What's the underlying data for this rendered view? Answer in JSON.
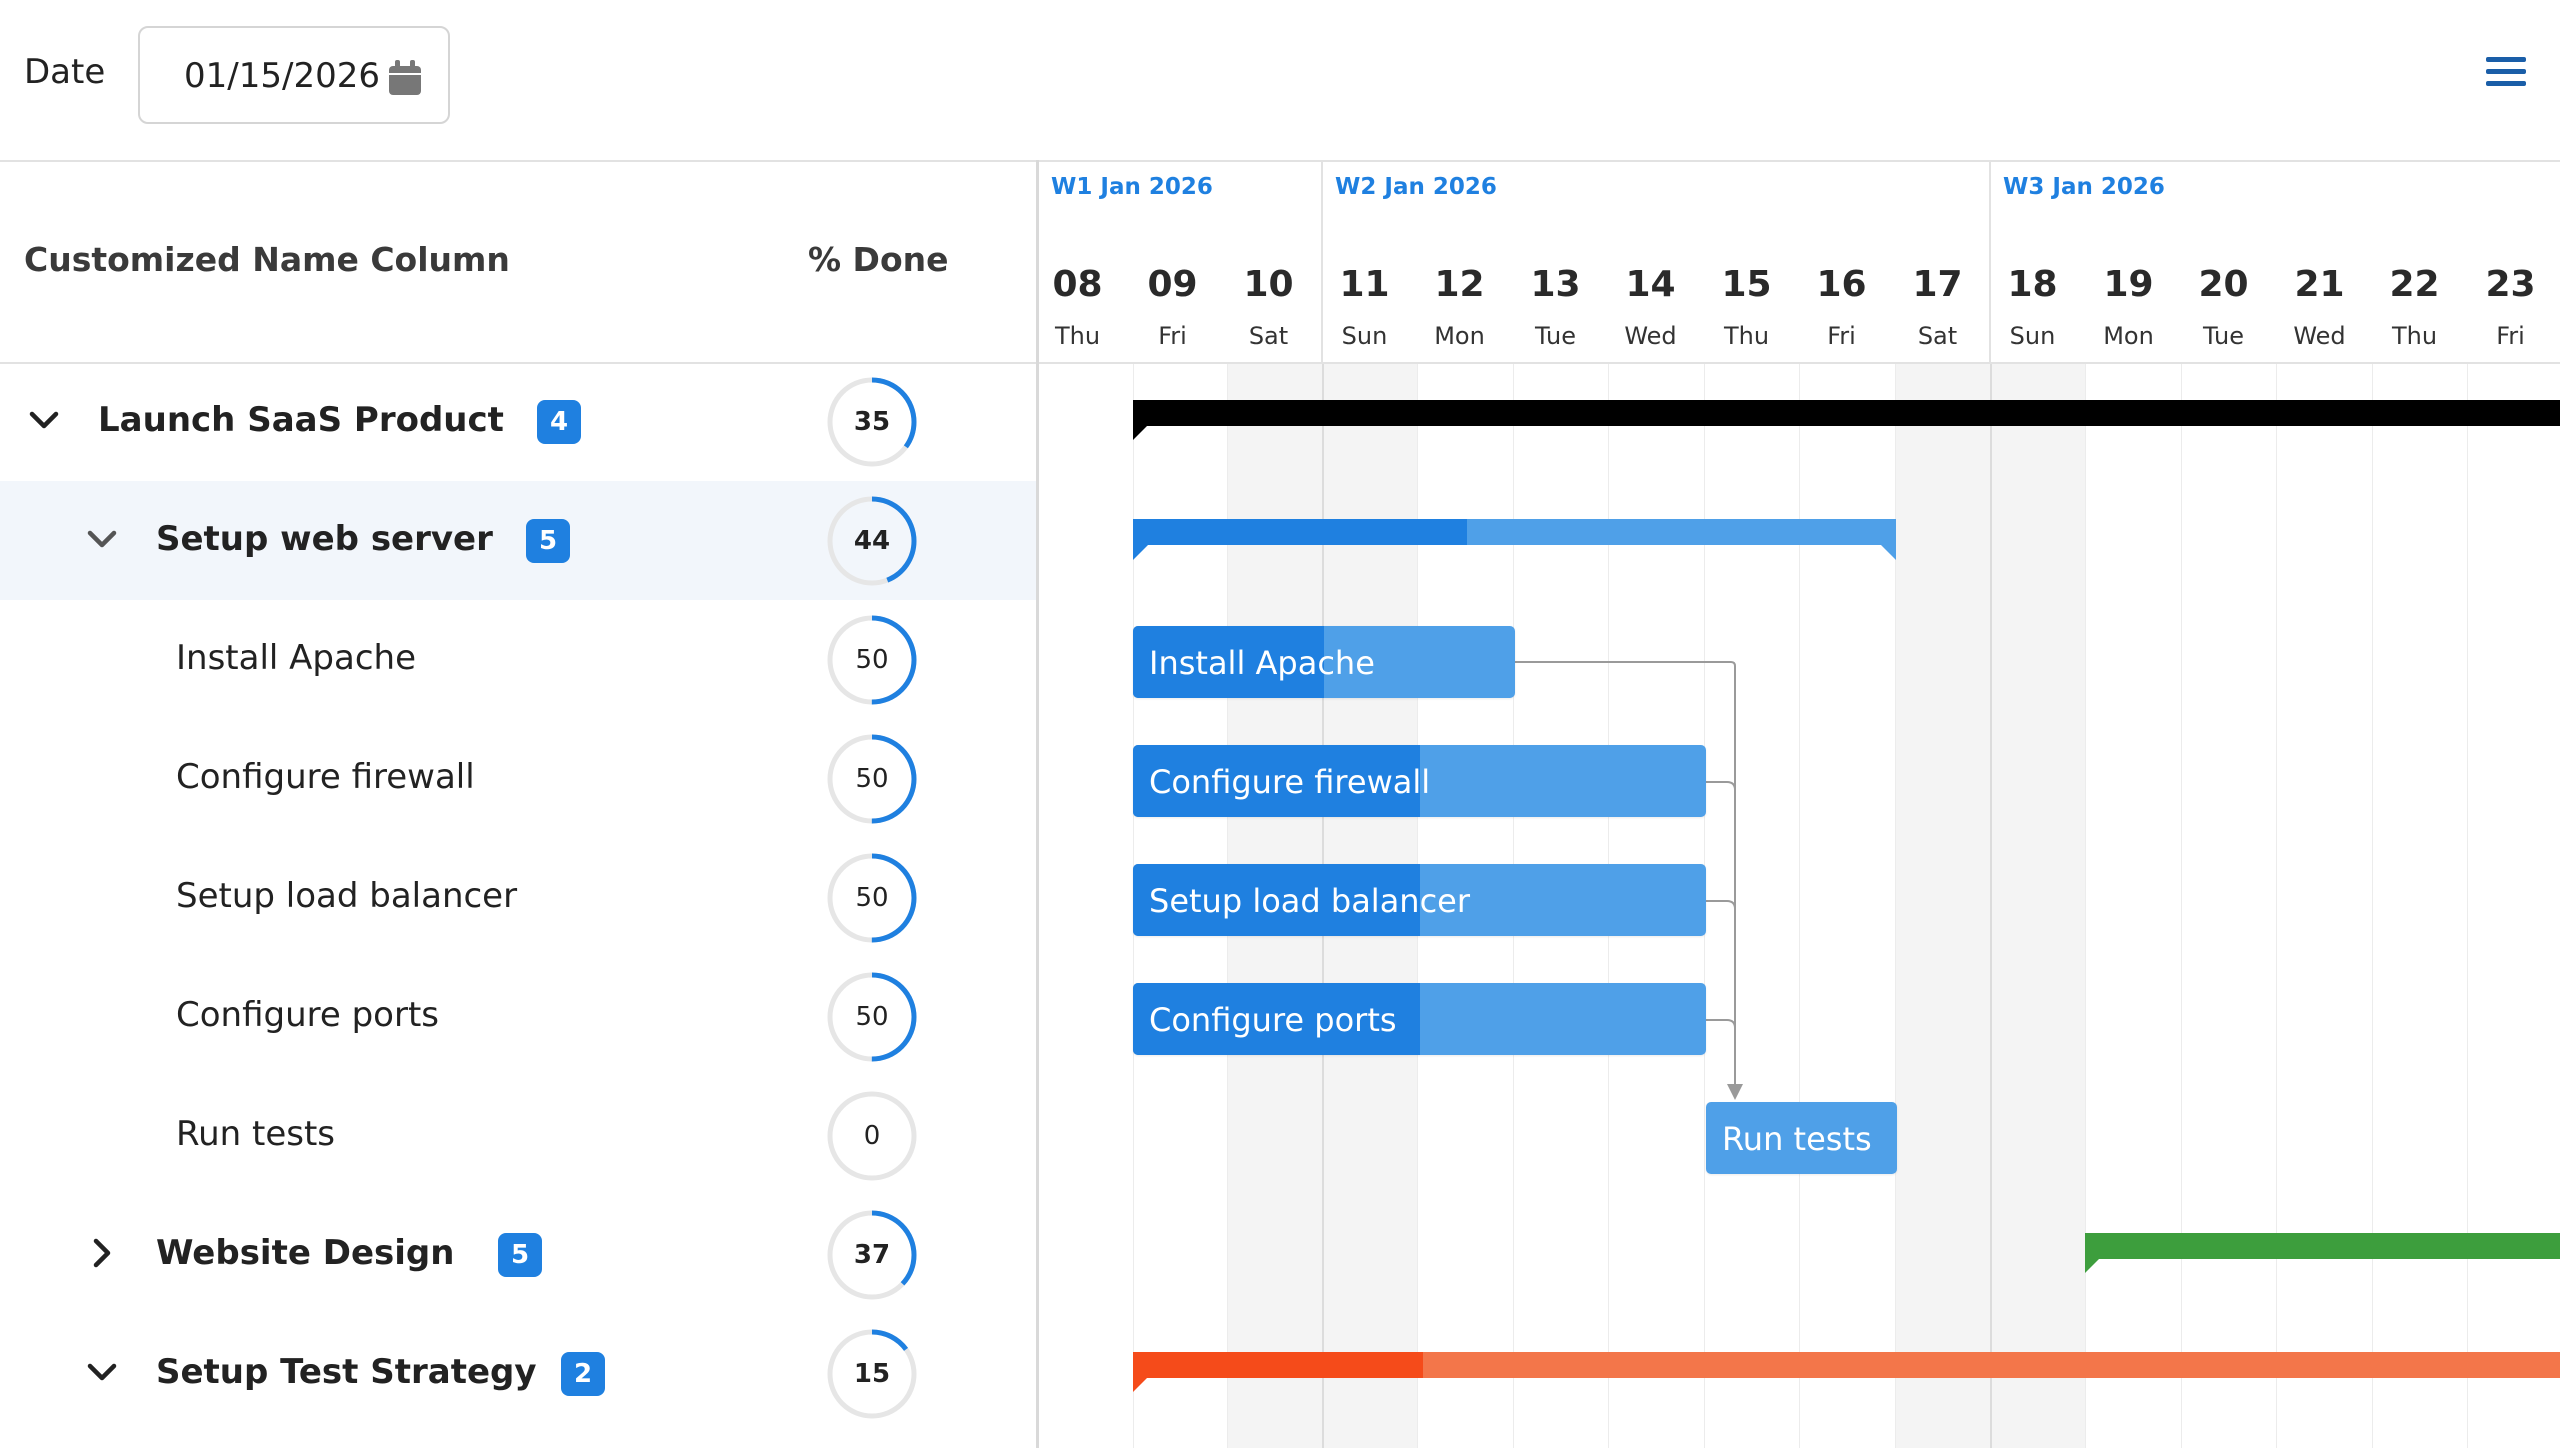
{
  "toolbar": {
    "date_label": "Date",
    "date_value": "01/15/2026"
  },
  "grid": {
    "name_header": "Customized Name Column",
    "done_header": "% Done",
    "rows": [
      {
        "name": "Launch SaaS Product",
        "percent": 35,
        "badge": "4",
        "expanded": true,
        "level": 0
      },
      {
        "name": "Setup web server",
        "percent": 44,
        "badge": "5",
        "expanded": true,
        "level": 1
      },
      {
        "name": "Install Apache",
        "percent": 50,
        "level": 2
      },
      {
        "name": "Configure firewall",
        "percent": 50,
        "level": 2
      },
      {
        "name": "Setup load balancer",
        "percent": 50,
        "level": 2
      },
      {
        "name": "Configure ports",
        "percent": 50,
        "level": 2
      },
      {
        "name": "Run tests",
        "percent": 0,
        "level": 2
      },
      {
        "name": "Website Design",
        "percent": 37,
        "badge": "5",
        "expanded": false,
        "level": 1
      },
      {
        "name": "Setup Test Strategy",
        "percent": 15,
        "badge": "2",
        "expanded": true,
        "level": 1
      }
    ]
  },
  "timeline": {
    "weeks": [
      "W1 Jan 2026",
      "W2 Jan 2026",
      "W3 Jan 2026"
    ],
    "days": [
      {
        "num": "08",
        "name": "Thu"
      },
      {
        "num": "09",
        "name": "Fri"
      },
      {
        "num": "10",
        "name": "Sat"
      },
      {
        "num": "11",
        "name": "Sun"
      },
      {
        "num": "12",
        "name": "Mon"
      },
      {
        "num": "13",
        "name": "Tue"
      },
      {
        "num": "14",
        "name": "Wed"
      },
      {
        "num": "15",
        "name": "Thu"
      },
      {
        "num": "16",
        "name": "Fri"
      },
      {
        "num": "17",
        "name": "Sat"
      },
      {
        "num": "18",
        "name": "Sun"
      },
      {
        "num": "19",
        "name": "Mon"
      },
      {
        "num": "20",
        "name": "Tue"
      },
      {
        "num": "21",
        "name": "Wed"
      },
      {
        "num": "22",
        "name": "Thu"
      },
      {
        "num": "23",
        "name": "Fri"
      }
    ],
    "task_labels": [
      "Install Apache",
      "Configure firewall",
      "Setup load balancer",
      "Configure ports",
      "Run tests"
    ]
  },
  "colors": {
    "accent": "#1f80e0",
    "accent_light": "#4fa0e8",
    "project_bar": "#000000",
    "design_bar": "#3d9e3d",
    "test_strategy_fill": "#f54b1a",
    "test_strategy_bar": "#f3764a"
  },
  "icons": {
    "calendar": "calendar-icon",
    "menu": "hamburger-menu-icon",
    "expanded": "chevron-down-icon",
    "collapsed": "chevron-right-icon"
  }
}
